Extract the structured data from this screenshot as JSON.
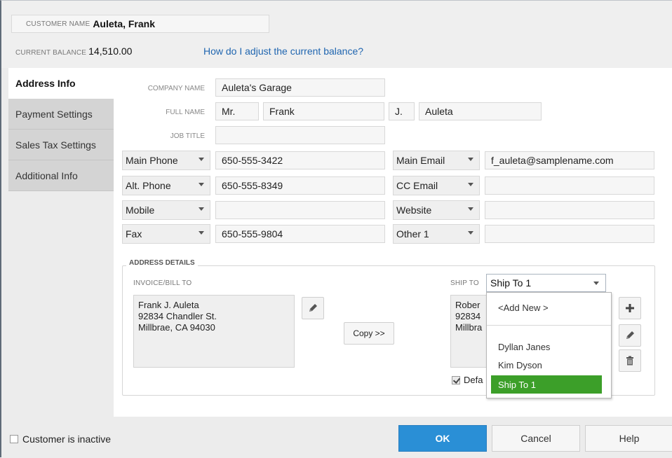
{
  "header": {
    "customer_name_label": "CUSTOMER NAME",
    "customer_name": "Auleta, Frank",
    "current_balance_label": "CURRENT BALANCE",
    "current_balance": "14,510.00",
    "adjust_link": "How do I adjust the current balance?"
  },
  "tabs": [
    {
      "label": "Address Info",
      "active": true
    },
    {
      "label": "Payment Settings",
      "active": false
    },
    {
      "label": "Sales Tax Settings",
      "active": false
    },
    {
      "label": "Additional Info",
      "active": false
    }
  ],
  "form": {
    "company_name_label": "COMPANY NAME",
    "company_name": "Auleta's Garage",
    "full_name_label": "FULL NAME",
    "salutation": "Mr.",
    "first_name": "Frank",
    "middle_initial": "J.",
    "last_name": "Auleta",
    "job_title_label": "JOB TITLE",
    "job_title": "",
    "phones": [
      {
        "type": "Main Phone",
        "value": "650-555-3422"
      },
      {
        "type": "Alt. Phone",
        "value": "650-555-8349"
      },
      {
        "type": "Mobile",
        "value": ""
      },
      {
        "type": "Fax",
        "value": "650-555-9804"
      }
    ],
    "contacts": [
      {
        "type": "Main Email",
        "value": "f_auleta@samplename.com"
      },
      {
        "type": "CC Email",
        "value": ""
      },
      {
        "type": "Website",
        "value": ""
      },
      {
        "type": "Other 1",
        "value": ""
      }
    ]
  },
  "address": {
    "section_title": "ADDRESS DETAILS",
    "bill_to_label": "INVOICE/BILL TO",
    "bill_to_lines": [
      "Frank J. Auleta",
      "92834 Chandler St.",
      "Millbrae, CA 94030"
    ],
    "copy_button": "Copy >>",
    "ship_to_label": "SHIP TO",
    "ship_to_selected": "Ship To 1",
    "ship_to_lines": [
      "Rober",
      "92834",
      "Millbra"
    ],
    "default_label": "Defa",
    "dropdown_items": [
      "<Add New >",
      "Dyllan Janes",
      "Kim Dyson",
      "Ship To 1"
    ]
  },
  "footer": {
    "inactive_label": "Customer is inactive",
    "ok": "OK",
    "cancel": "Cancel",
    "help": "Help"
  },
  "colors": {
    "ok_button": "#2a8fd6",
    "selected_item": "#3c9f29",
    "link": "#2066b0"
  }
}
